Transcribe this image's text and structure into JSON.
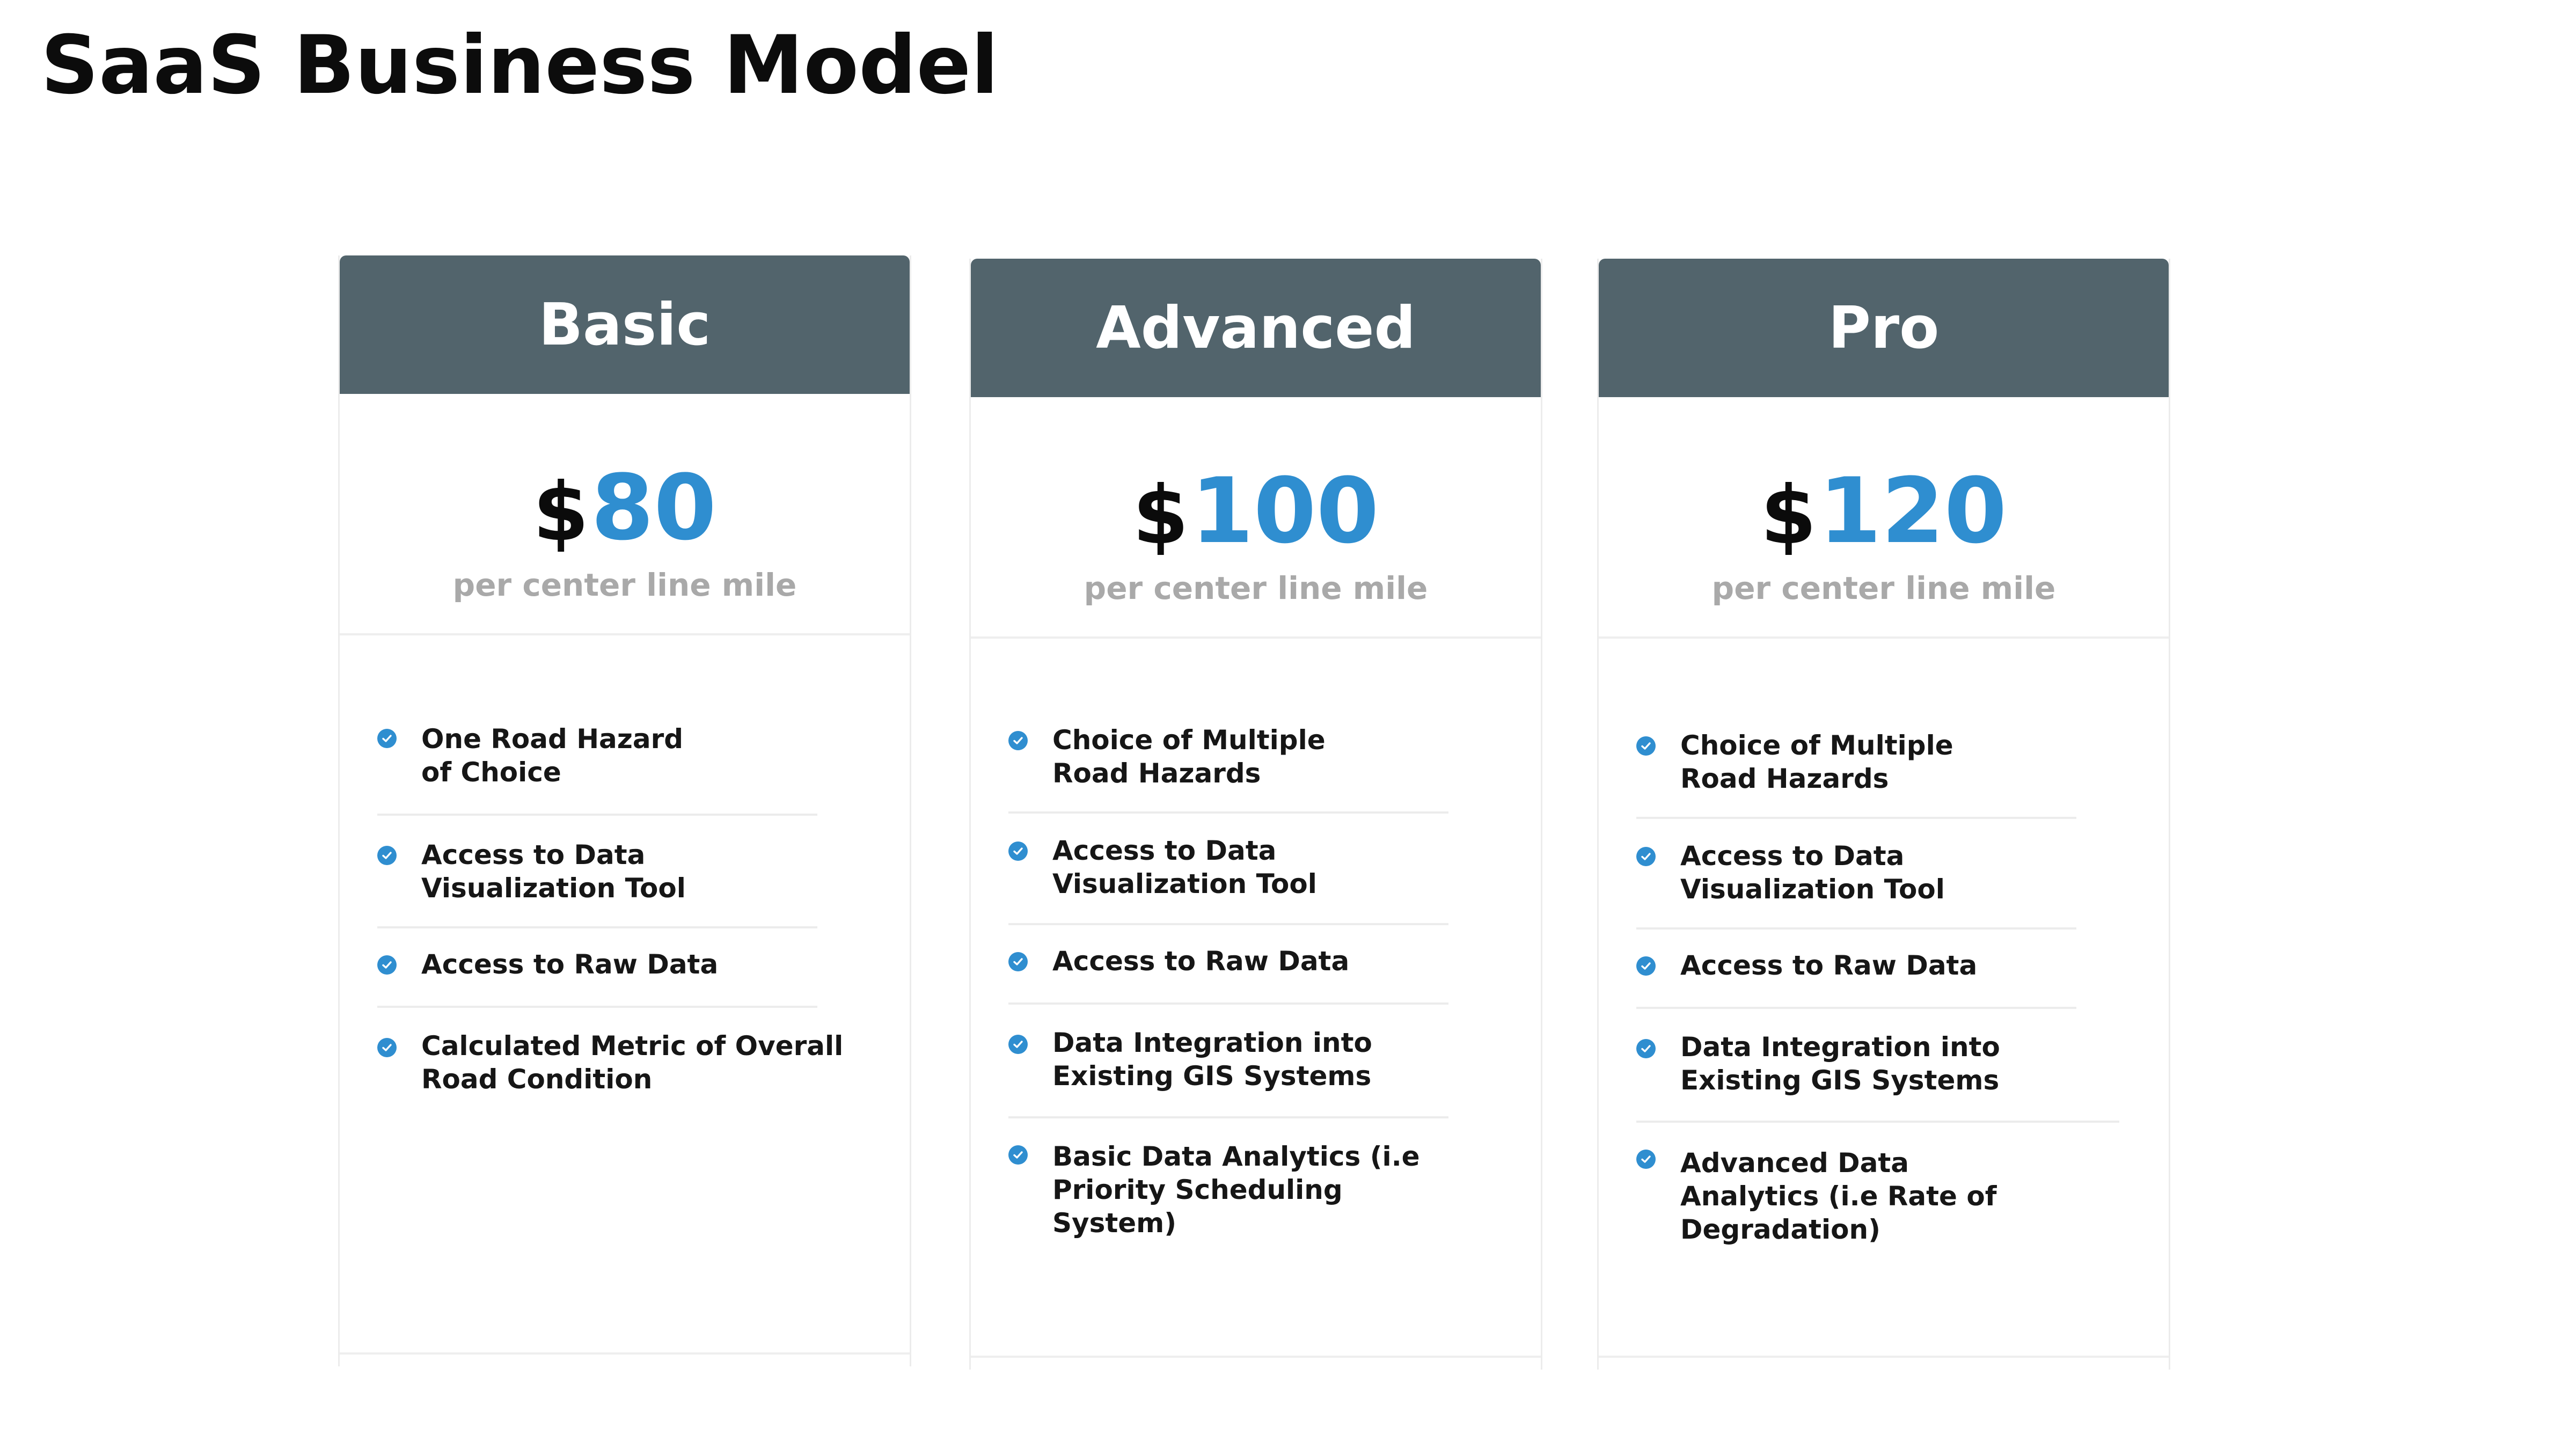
{
  "page": {
    "title": "SaaS Business Model"
  },
  "colors": {
    "header_bg": "#52646c",
    "price_accent": "#2f8ed0",
    "check_icon": "#2f8ed0",
    "muted_text": "#a9a9a9"
  },
  "plans": [
    {
      "name": "Basic",
      "currency": "$",
      "amount": "80",
      "unit": "per center line mile",
      "features": [
        "One Road Hazard of Choice",
        "Access to Data Visualization Tool",
        "Access to Raw Data",
        "Calculated Metric of Overall Road Condition"
      ]
    },
    {
      "name": "Advanced",
      "currency": "$",
      "amount": "100",
      "unit": "per center line mile",
      "features": [
        "Choice of Multiple Road Hazards",
        "Access to Data Visualization Tool",
        "Access to Raw Data",
        "Data Integration into Existing GIS Systems",
        "Basic Data Analytics (i.e Priority Scheduling System)"
      ]
    },
    {
      "name": "Pro",
      "currency": "$",
      "amount": "120",
      "unit": "per center line mile",
      "features": [
        "Choice of Multiple Road Hazards",
        "Access to Data Visualization Tool",
        "Access to Raw Data",
        "Data Integration into Existing GIS Systems",
        "Advanced Data Analytics (i.e Rate of Degradation)"
      ]
    }
  ]
}
